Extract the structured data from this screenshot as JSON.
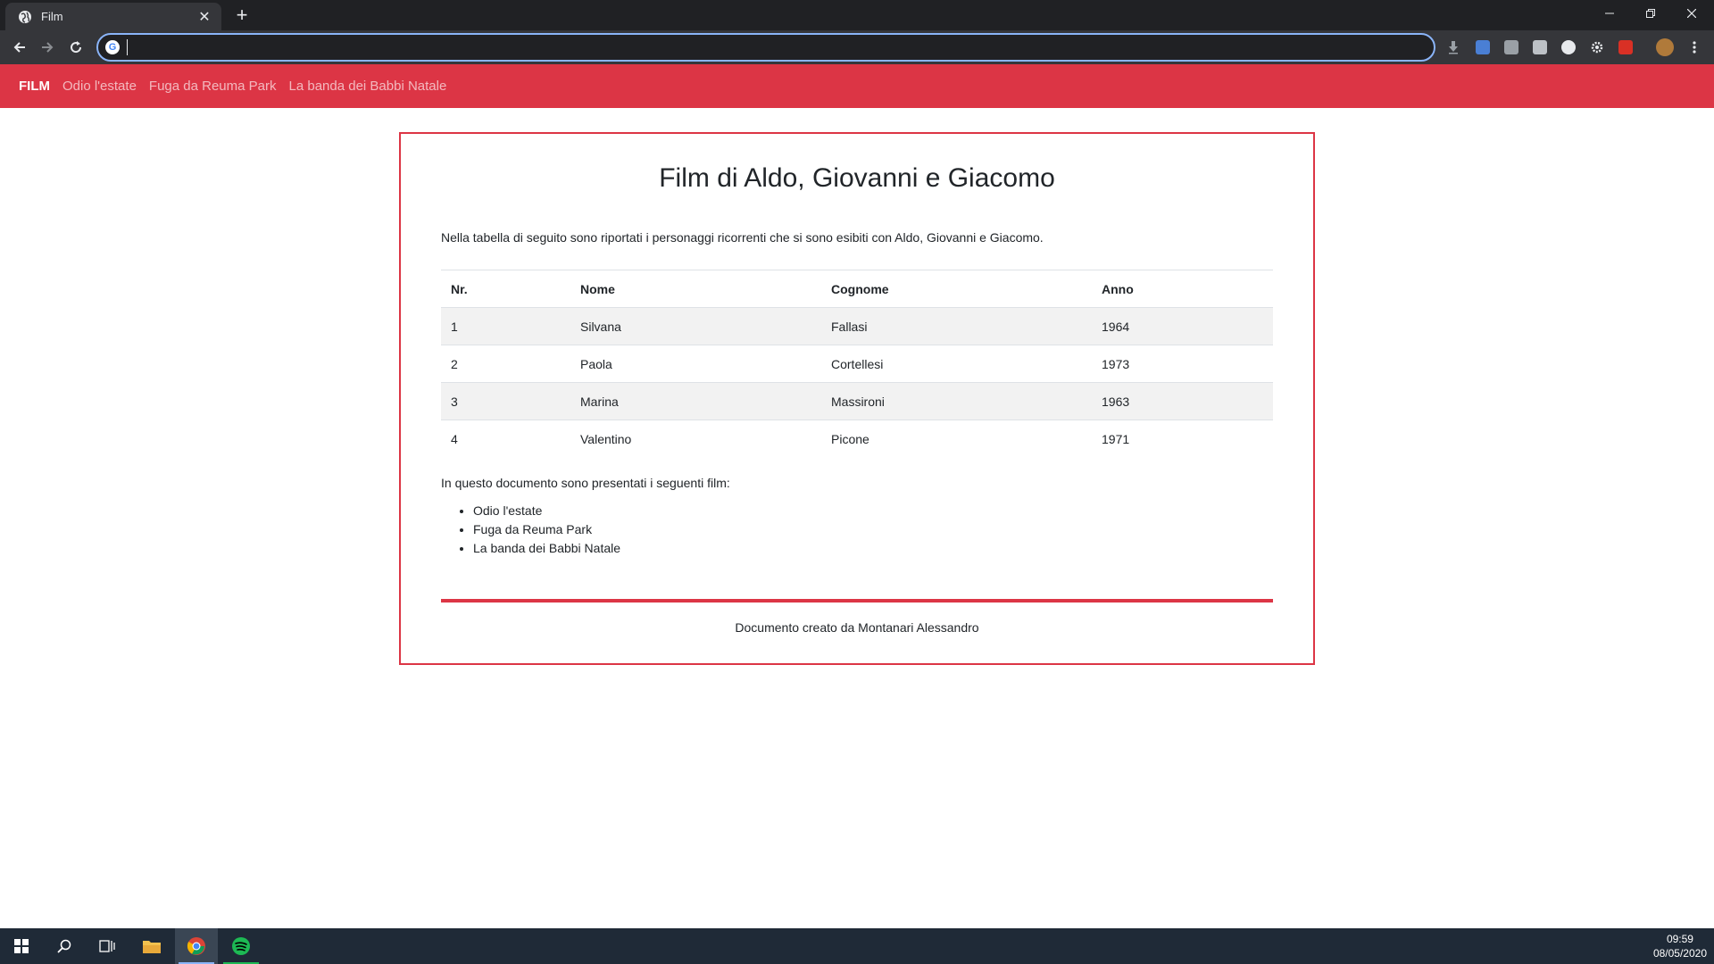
{
  "browser": {
    "tab_title": "Film",
    "tab_close_glyph": "✕",
    "new_tab_glyph": "+",
    "address_value": "",
    "window_controls": [
      "minimize-icon",
      "restore-icon",
      "close-icon"
    ]
  },
  "navbar": {
    "brand": "FILM",
    "links": [
      "Odio l'estate",
      "Fuga da Reuma Park",
      "La banda dei Babbi Natale"
    ]
  },
  "main": {
    "title": "Film di Aldo, Giovanni e Giacomo",
    "intro": "Nella tabella di seguito sono riportati i personaggi ricorrenti che si sono esibiti con Aldo, Giovanni e Giacomo.",
    "table": {
      "headers": [
        "Nr.",
        "Nome",
        "Cognome",
        "Anno"
      ],
      "rows": [
        [
          "1",
          "Silvana",
          "Fallasi",
          "1964"
        ],
        [
          "2",
          "Paola",
          "Cortellesi",
          "1973"
        ],
        [
          "3",
          "Marina",
          "Massironi",
          "1963"
        ],
        [
          "4",
          "Valentino",
          "Picone",
          "1971"
        ]
      ]
    },
    "list_intro": "In questo documento sono presentati i seguenti film:",
    "films": [
      "Odio l'estate",
      "Fuga da Reuma Park",
      "La banda dei Babbi Natale"
    ],
    "footer": "Documento creato da Montanari Alessandro"
  },
  "taskbar": {
    "time": "09:59",
    "date": "08/05/2020"
  },
  "colors": {
    "accent": "#dc3545",
    "chrome_dark": "#202124",
    "chrome_toolbar": "#35363a",
    "taskbar": "#1f2a37"
  }
}
